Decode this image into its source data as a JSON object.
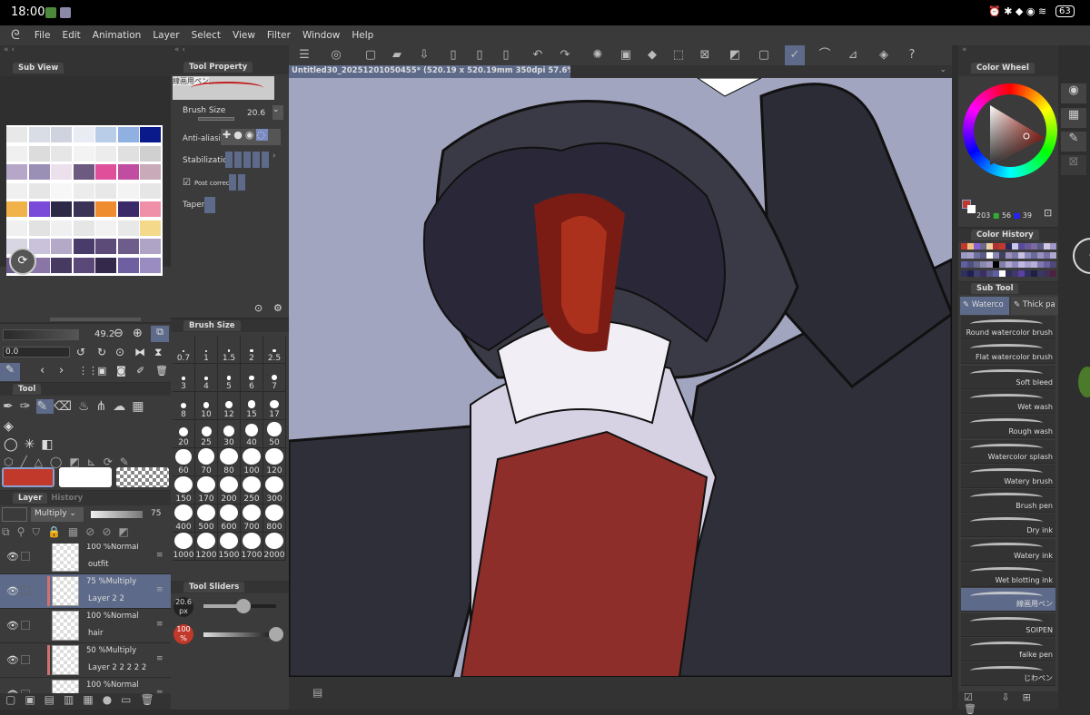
{
  "status": {
    "time": "18:00",
    "battery": "63"
  },
  "menu": [
    "File",
    "Edit",
    "Animation",
    "Layer",
    "Select",
    "View",
    "Filter",
    "Window",
    "Help"
  ],
  "subview": {
    "title": "Sub View",
    "palette": [
      [
        "#e8e8e8",
        "#d9dde6",
        "#cfd3e0",
        "#e9ecf3",
        "#b9cde8",
        "#8fb0e0",
        "#0a1a8a"
      ],
      [
        "#f0f0f0",
        "#dcdcdc",
        "#e6e6e6",
        "#f3f3f3",
        "#ececec",
        "#e0e0e0",
        "#d0d0d0"
      ],
      [
        "#b6a7c8",
        "#9a8fb5",
        "#ece0ec",
        "#6c5a80",
        "#e0509a",
        "#c04da0",
        "#c8aab8"
      ],
      [
        "#f0f0f0",
        "#e6e6e6",
        "#f7f7f7",
        "#ececec",
        "#e8e8e8",
        "#f3f3f3",
        "#e6e6e6"
      ],
      [
        "#f2b24a",
        "#7a4ad8",
        "#2d2a48",
        "#3a3355",
        "#f08c30",
        "#3b2a6a",
        "#f090a8"
      ],
      [
        "#f0f0f0",
        "#e2e2e2",
        "#f0f0f0",
        "#e6e6e6",
        "#f2f2f2",
        "#e8e8e8",
        "#f5d98a"
      ],
      [
        "#d9d6e4",
        "#c9c2da",
        "#b4aac8",
        "#4a3c6a",
        "#5c4b78",
        "#6e5c8a",
        "#b0a4c6"
      ],
      [
        "#6a5a88",
        "#8a76a6",
        "#463a60",
        "#5a4878",
        "#34294a",
        "#6e60a0",
        "#9a8cc0"
      ]
    ]
  },
  "color_sliders": {
    "value1": "49.2",
    "value2": "0.0"
  },
  "tool": {
    "title": "Tool"
  },
  "colors": {
    "main": "#c0392b",
    "sub": "#ffffff"
  },
  "layer": {
    "title": "Layer",
    "history_tab": "History",
    "blend_mode": "Multiply",
    "opacity": "75",
    "layers": [
      {
        "opacity": "100 %Normal",
        "name": "outfit"
      },
      {
        "opacity": "75 %Multiply",
        "name": "Layer 2 2"
      },
      {
        "opacity": "100 %Normal",
        "name": "hair"
      },
      {
        "opacity": "50 %Multiply",
        "name": "Layer 2 2 2 2 2"
      },
      {
        "opacity": "100 %Normal",
        "name": ""
      }
    ]
  },
  "tool_property": {
    "title": "Tool Property",
    "brush_name": "線画用ペン",
    "brush_size_label": "Brush Size",
    "brush_size": "20.6",
    "anti_aliasing": "Anti-aliasing",
    "stabilization": "Stabilization",
    "post_correction": "Post correct",
    "taper": "Taper"
  },
  "brush_size_panel": {
    "title": "Brush Size",
    "sizes": [
      "0.7",
      "1",
      "1.5",
      "2",
      "2.5",
      "3",
      "4",
      "5",
      "6",
      "7",
      "8",
      "10",
      "12",
      "15",
      "17",
      "20",
      "25",
      "30",
      "40",
      "50",
      "60",
      "70",
      "80",
      "100",
      "120",
      "150",
      "170",
      "200",
      "250",
      "300",
      "400",
      "500",
      "600",
      "700",
      "800",
      "1000",
      "1200",
      "1500",
      "1700",
      "2000"
    ]
  },
  "tool_sliders": {
    "title": "Tool Sliders",
    "size": "20.6",
    "size_unit": "px",
    "opacity": "100",
    "opacity_unit": "%"
  },
  "canvas": {
    "tab_title": "Untitled30_20251201050455* (520.19 x 520.19mm 350dpi 57.6%)",
    "background": "#a2a5bf"
  },
  "color_wheel": {
    "title": "Color Wheel",
    "r": "203",
    "g": "56",
    "b": "39"
  },
  "color_history": {
    "title": "Color History",
    "swatches": [
      "#c0392b",
      "#f0c080",
      "#8a60d8",
      "#6a6a8a",
      "#f0d0a0",
      "#b03030",
      "#c03a30",
      "#2a2a5a",
      "#c8c8e8",
      "#5a4a9a",
      "#6a5a9a",
      "#7a6aa0",
      "#5a5a88",
      "#d0c8e0",
      "#a098c8",
      "#9a98c0",
      "#a8a0c8",
      "#7070a0",
      "#5a5a88",
      "#ffffff",
      "#8888b0",
      "#404060",
      "#9a90b8",
      "#7a78a8",
      "#c8c0e0",
      "#8a88b8",
      "#6a6a98",
      "#9a90c0",
      "#7a70a8",
      "#b0a8d0",
      "#6060a0",
      "#505080",
      "#6a6a90",
      "#8a8ab0",
      "#a098c0",
      "#000000",
      "#8080a8",
      "#b0a8d0",
      "#9088c0",
      "#c0b8e0",
      "#a8a0d0",
      "#b8b0d8",
      "#8078b0",
      "#6a60a0",
      "#504878",
      "#303060",
      "#202050",
      "#404070",
      "#3a3060",
      "#505080",
      "#6060a0",
      "#ffffff",
      "#303058",
      "#403868",
      "#5a40a0",
      "#303060",
      "#202040",
      "#383860",
      "#403058",
      "#502040"
    ]
  },
  "sub_tool": {
    "title": "Sub Tool",
    "groups": [
      "Waterco",
      "Thick pa"
    ],
    "items": [
      "Round watercolor brush",
      "Flat watercolor brush",
      "Soft bleed",
      "Wet wash",
      "Rough wash",
      "Watercolor splash",
      "Watery brush",
      "Brush pen",
      "Dry ink",
      "Watery ink",
      "Wet blotting ink",
      "線画用ペン",
      "SOIPEN",
      "falke pen",
      "じわペン"
    ],
    "selected": "線画用ペン"
  }
}
